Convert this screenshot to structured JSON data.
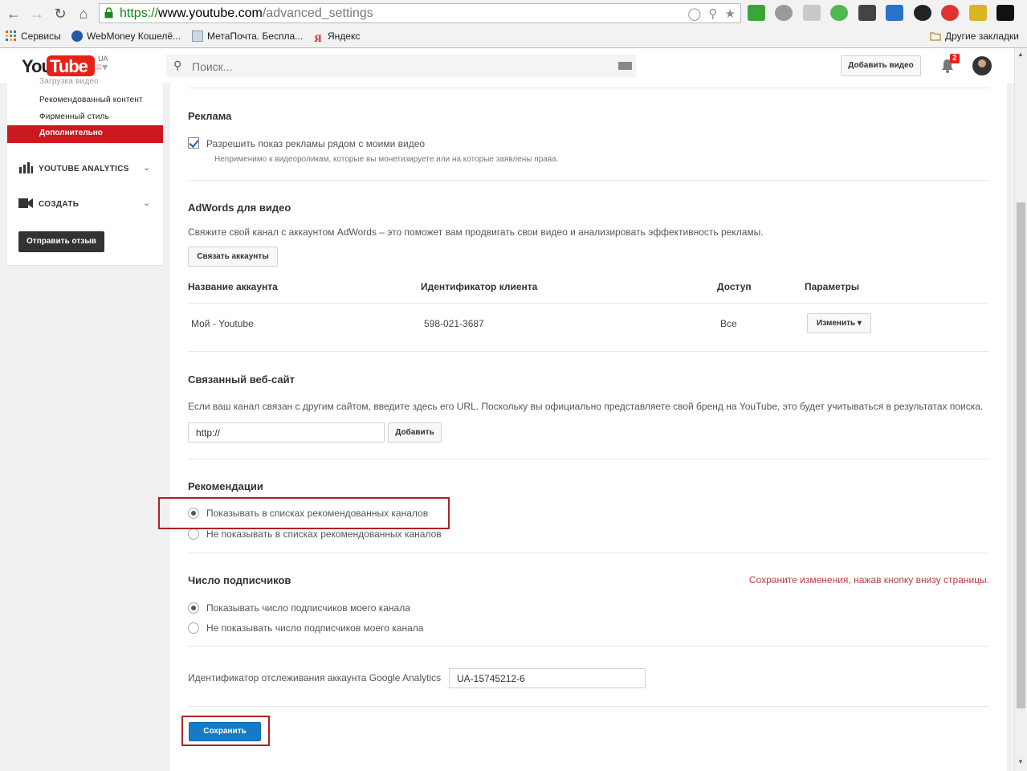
{
  "browser": {
    "url_protocol": "https://",
    "url_host": "www.youtube.com",
    "url_path": "/advanced_settings",
    "bookmarks": [
      {
        "label": "Сервисы"
      },
      {
        "label": "WebMoney Кошелё..."
      },
      {
        "label": "МетаПочта. Беспла..."
      },
      {
        "label": "Яндекс"
      }
    ],
    "other_bookmarks": "Другие закладки"
  },
  "header": {
    "logo_you": "You",
    "logo_tube": "Tube",
    "region": "UA",
    "search_placeholder": "Поиск...",
    "upload_label": "Добавить видео",
    "notification_count": "2"
  },
  "sidebar": {
    "items": [
      {
        "label": "Загрузка видео"
      },
      {
        "label": "Рекомендованный контент"
      },
      {
        "label": "Фирменный стиль"
      },
      {
        "label": "Дополнительно",
        "active": true
      }
    ],
    "sections": [
      {
        "label": "YOUTUBE ANALYTICS"
      },
      {
        "label": "СОЗДАТЬ"
      }
    ],
    "feedback_label": "Отправить отзыв"
  },
  "ads": {
    "title": "Реклама",
    "checkbox_label": "Разрешить показ рекламы рядом с моими видео",
    "checked": true,
    "note": "Неприменимо к видеороликам, которые вы монетизируете или на которые заявлены права."
  },
  "adwords": {
    "title": "AdWords для видео",
    "description": "Свяжите свой канал с аккаунтом AdWords – это поможет вам продвигать свои видео и анализировать эффективность рекламы.",
    "link_button": "Связать аккаунты",
    "columns": [
      "Название аккаунта",
      "Идентификатор клиента",
      "Доступ",
      "Параметры"
    ],
    "rows": [
      {
        "name": "Мой - Youtube",
        "client_id": "598-021-3687",
        "access": "Все",
        "action": "Изменить"
      }
    ]
  },
  "website": {
    "title": "Связанный веб-сайт",
    "description": "Если ваш канал связан с другим сайтом, введите здесь его URL. Поскольку вы официально представляете свой бренд на YouTube, это будет учитываться в результатах поиска.",
    "url_value": "http://",
    "add_button": "Добавить"
  },
  "recommendations": {
    "title": "Рекомендации",
    "options": [
      {
        "label": "Показывать в списках рекомендованных каналов",
        "selected": true
      },
      {
        "label": "Не показывать в списках рекомендованных каналов",
        "selected": false
      }
    ]
  },
  "subscribers": {
    "title": "Число подписчиков",
    "save_note": "Сохраните изменения, нажав кнопку внизу страницы.",
    "options": [
      {
        "label": "Показывать число подписчиков моего канала",
        "selected": true
      },
      {
        "label": "Не показывать число подписчиков моего канала",
        "selected": false
      }
    ]
  },
  "analytics": {
    "label": "Идентификатор отслеживания аккаунта Google Analytics",
    "value": "UA-15745212-6"
  },
  "save_button": "Сохранить",
  "colors": {
    "youtube_red": "#e62117",
    "sidebar_active": "#cc181e",
    "save_blue": "#167ac6",
    "highlight_box": "#b02020",
    "note_red": "#b93d3d"
  }
}
